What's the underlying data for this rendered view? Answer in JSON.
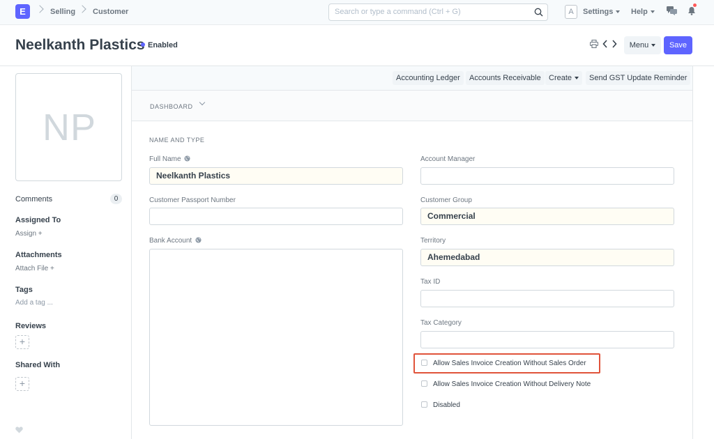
{
  "navbar": {
    "logo_letter": "E",
    "breadcrumbs": [
      "Selling",
      "Customer"
    ],
    "search_placeholder": "Search or type a command (Ctrl + G)",
    "avatar_letter": "A",
    "settings_label": "Settings",
    "help_label": "Help"
  },
  "header": {
    "title": "Neelkanth Plastics",
    "status": "Enabled",
    "menu_label": "Menu",
    "save_label": "Save"
  },
  "sidebar": {
    "avatar_initials": "NP",
    "comments_label": "Comments",
    "comments_count": "0",
    "assigned_to_label": "Assigned To",
    "assign_link": "Assign +",
    "attachments_label": "Attachments",
    "attach_file_link": "Attach File +",
    "tags_label": "Tags",
    "add_tag_link": "Add a tag ...",
    "reviews_label": "Reviews",
    "shared_with_label": "Shared With",
    "add_symbol": "+"
  },
  "toolbar": {
    "buttons": [
      "Accounting Ledger",
      "Accounts Receivable",
      "Create",
      "Send GST Update Reminder"
    ]
  },
  "dashboard": {
    "label": "DASHBOARD"
  },
  "form": {
    "section_title": "NAME AND TYPE",
    "full_name_label": "Full Name",
    "full_name_value": "Neelkanth Plastics",
    "passport_label": "Customer Passport Number",
    "passport_value": "",
    "bank_account_label": "Bank Account",
    "account_manager_label": "Account Manager",
    "account_manager_value": "",
    "customer_group_label": "Customer Group",
    "customer_group_value": "Commercial",
    "territory_label": "Territory",
    "territory_value": "Ahemedabad",
    "tax_id_label": "Tax ID",
    "tax_id_value": "",
    "tax_category_label": "Tax Category",
    "tax_category_value": "",
    "checkboxes": [
      "Allow Sales Invoice Creation Without Sales Order",
      "Allow Sales Invoice Creation Without Delivery Note",
      "Disabled"
    ]
  },
  "colors": {
    "accent": "#5e64ff",
    "highlight_border": "#e0533a",
    "filled_field_bg": "#fffdf4"
  }
}
